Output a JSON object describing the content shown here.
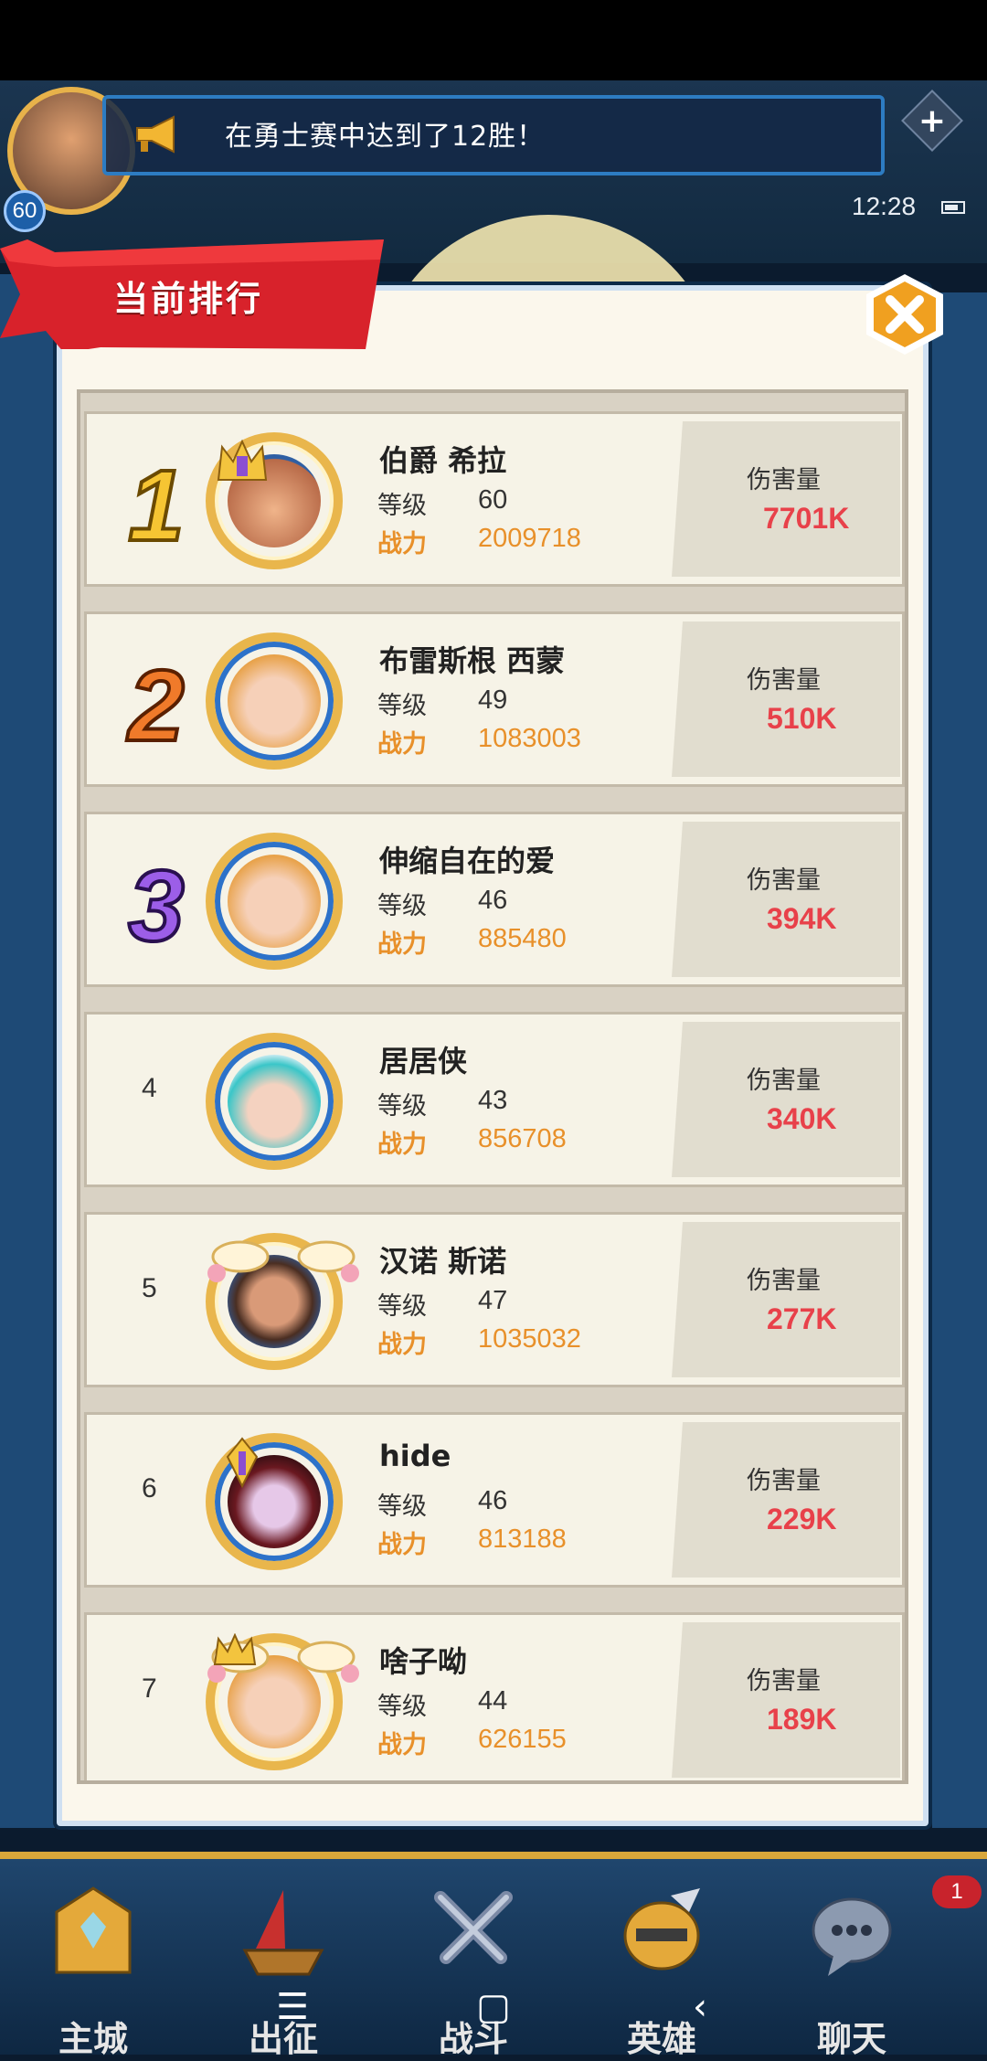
{
  "hud": {
    "player_level": "60",
    "notice": "在勇士赛中达到了12胜！",
    "time": "12:28"
  },
  "panel": {
    "title": "当前排行"
  },
  "ranking": {
    "level_label": "等级",
    "power_label": "战力",
    "damage_label": "伤害量",
    "rows": [
      {
        "rank": "1",
        "name": "伯爵 希拉",
        "level": "60",
        "power": "2009718",
        "damage": "7701K"
      },
      {
        "rank": "2",
        "name": "布雷斯根 西蒙",
        "level": "49",
        "power": "1083003",
        "damage": "510K"
      },
      {
        "rank": "3",
        "name": "伸缩自在的爱",
        "level": "46",
        "power": "885480",
        "damage": "394K"
      },
      {
        "rank": "4",
        "name": "居居侠",
        "level": "43",
        "power": "856708",
        "damage": "340K"
      },
      {
        "rank": "5",
        "name": "汉诺 斯诺",
        "level": "47",
        "power": "1035032",
        "damage": "277K"
      },
      {
        "rank": "6",
        "name": "hide",
        "level": "46",
        "power": "813188",
        "damage": "229K"
      },
      {
        "rank": "7",
        "name": "啥子呦",
        "level": "44",
        "power": "626155",
        "damage": "189K"
      }
    ]
  },
  "nav": {
    "items": [
      {
        "label": "主城",
        "icon": "castle-icon"
      },
      {
        "label": "出征",
        "icon": "ship-icon"
      },
      {
        "label": "战斗",
        "icon": "swords-icon"
      },
      {
        "label": "英雄",
        "icon": "hero-helmet-icon"
      },
      {
        "label": "聊天",
        "icon": "chat-icon"
      }
    ],
    "chat_badge": "1"
  },
  "colors": {
    "damage": "#e8414a",
    "power": "#e8902a",
    "banner": "#d8222b",
    "close": "#f0a020"
  }
}
